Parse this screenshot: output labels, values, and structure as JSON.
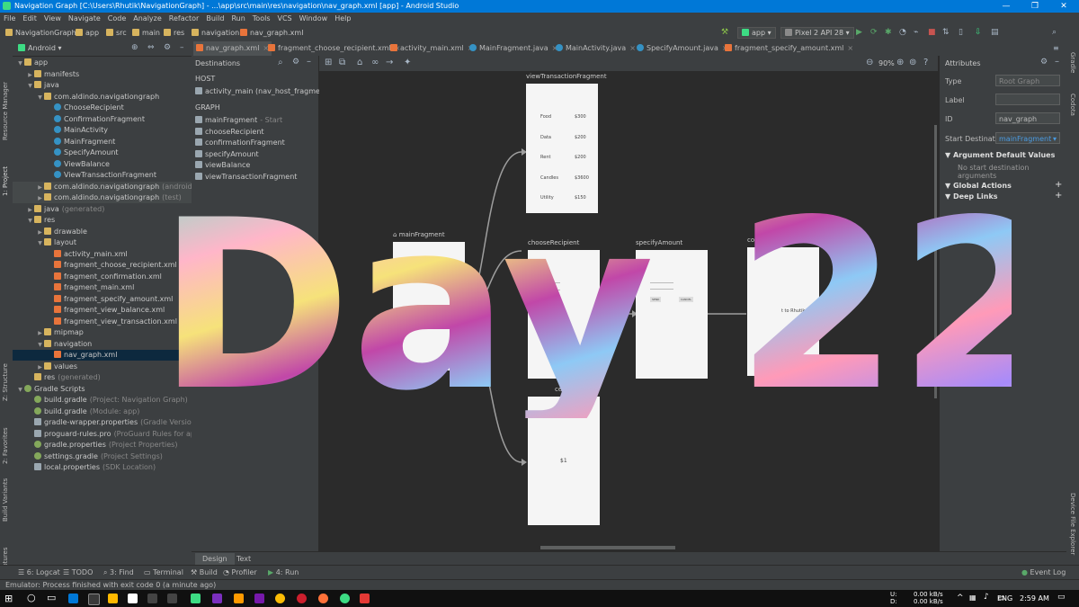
{
  "window": {
    "title": "Navigation Graph [C:\\Users\\Rhutik\\NavigationGraph] - ...\\app\\src\\main\\res\\navigation\\nav_graph.xml [app] - Android Studio",
    "controls": {
      "minimize": "—",
      "restore": "❐",
      "close": "✕"
    }
  },
  "menu": [
    "File",
    "Edit",
    "View",
    "Navigate",
    "Code",
    "Analyze",
    "Refactor",
    "Build",
    "Run",
    "Tools",
    "VCS",
    "Window",
    "Help"
  ],
  "breadcrumb": [
    "NavigationGraph",
    "app",
    "src",
    "main",
    "res",
    "navigation",
    "nav_graph.xml"
  ],
  "toolbar": {
    "module": "app",
    "device": "Pixel 2 API 28"
  },
  "project_panel": {
    "view_mode": "Android"
  },
  "tree": [
    {
      "label": "app",
      "level": 0,
      "icon": "folder",
      "arrow": "▼"
    },
    {
      "label": "manifests",
      "level": 1,
      "icon": "folder",
      "arrow": "▶"
    },
    {
      "label": "java",
      "level": 1,
      "icon": "folder",
      "arrow": "▼"
    },
    {
      "label": "com.aldindo.navigationgraph",
      "level": 2,
      "icon": "folder",
      "arrow": "▼"
    },
    {
      "label": "ChooseRecipient",
      "level": 3,
      "icon": "cls",
      "arrow": ""
    },
    {
      "label": "ConfirmationFragment",
      "level": 3,
      "icon": "cls",
      "arrow": ""
    },
    {
      "label": "MainActivity",
      "level": 3,
      "icon": "cls",
      "arrow": ""
    },
    {
      "label": "MainFragment",
      "level": 3,
      "icon": "cls",
      "arrow": ""
    },
    {
      "label": "SpecifyAmount",
      "level": 3,
      "icon": "cls",
      "arrow": ""
    },
    {
      "label": "ViewBalance",
      "level": 3,
      "icon": "cls",
      "arrow": ""
    },
    {
      "label": "ViewTransactionFragment",
      "level": 3,
      "icon": "cls",
      "arrow": ""
    },
    {
      "label": "com.aldindo.navigationgraph",
      "suffix": "(androidTest)",
      "level": 2,
      "icon": "folder",
      "arrow": "▶",
      "hl": true
    },
    {
      "label": "com.aldindo.navigationgraph",
      "suffix": "(test)",
      "level": 2,
      "icon": "folder",
      "arrow": "▶",
      "hl": true
    },
    {
      "label": "java",
      "suffix": "(generated)",
      "level": 1,
      "icon": "folder",
      "arrow": "▶"
    },
    {
      "label": "res",
      "level": 1,
      "icon": "folder",
      "arrow": "▼"
    },
    {
      "label": "drawable",
      "level": 2,
      "icon": "folder",
      "arrow": "▶"
    },
    {
      "label": "layout",
      "level": 2,
      "icon": "folder",
      "arrow": "▼"
    },
    {
      "label": "activity_main.xml",
      "level": 3,
      "icon": "xml",
      "arrow": ""
    },
    {
      "label": "fragment_choose_recipient.xml",
      "level": 3,
      "icon": "xml",
      "arrow": ""
    },
    {
      "label": "fragment_confirmation.xml",
      "level": 3,
      "icon": "xml",
      "arrow": ""
    },
    {
      "label": "fragment_main.xml",
      "level": 3,
      "icon": "xml",
      "arrow": ""
    },
    {
      "label": "fragment_specify_amount.xml",
      "level": 3,
      "icon": "xml",
      "arrow": ""
    },
    {
      "label": "fragment_view_balance.xml",
      "level": 3,
      "icon": "xml",
      "arrow": ""
    },
    {
      "label": "fragment_view_transaction.xml",
      "level": 3,
      "icon": "xml",
      "arrow": ""
    },
    {
      "label": "mipmap",
      "level": 2,
      "icon": "folder",
      "arrow": "▶"
    },
    {
      "label": "navigation",
      "level": 2,
      "icon": "folder",
      "arrow": "▼"
    },
    {
      "label": "nav_graph.xml",
      "level": 3,
      "icon": "xml",
      "arrow": "",
      "sel": true
    },
    {
      "label": "values",
      "level": 2,
      "icon": "folder",
      "arrow": "▶"
    },
    {
      "label": "res",
      "suffix": "(generated)",
      "level": 1,
      "icon": "folder",
      "arrow": ""
    },
    {
      "label": "Gradle Scripts",
      "level": 0,
      "icon": "gradle",
      "arrow": "▼"
    },
    {
      "label": "build.gradle",
      "suffix": "(Project: Navigation Graph)",
      "level": 1,
      "icon": "gradle",
      "arrow": ""
    },
    {
      "label": "build.gradle",
      "suffix": "(Module: app)",
      "level": 1,
      "icon": "gradle",
      "arrow": ""
    },
    {
      "label": "gradle-wrapper.properties",
      "suffix": "(Gradle Version)",
      "level": 1,
      "icon": "file",
      "arrow": ""
    },
    {
      "label": "proguard-rules.pro",
      "suffix": "(ProGuard Rules for app)",
      "level": 1,
      "icon": "file",
      "arrow": ""
    },
    {
      "label": "gradle.properties",
      "suffix": "(Project Properties)",
      "level": 1,
      "icon": "gradle",
      "arrow": ""
    },
    {
      "label": "settings.gradle",
      "suffix": "(Project Settings)",
      "level": 1,
      "icon": "gradle",
      "arrow": ""
    },
    {
      "label": "local.properties",
      "suffix": "(SDK Location)",
      "level": 1,
      "icon": "file",
      "arrow": ""
    }
  ],
  "tabs": [
    "nav_graph.xml",
    "fragment_choose_recipient.xml",
    "activity_main.xml",
    "MainFragment.java",
    "MainActivity.java",
    "SpecifyAmount.java",
    "fragment_specify_amount.xml"
  ],
  "destinations": {
    "title": "Destinations",
    "host_header": "HOST",
    "host": "activity_main (nav_host_fragment)",
    "graph_header": "GRAPH",
    "items": [
      {
        "name": "mainFragment",
        "note": "- Start"
      },
      {
        "name": "chooseRecipient",
        "note": ""
      },
      {
        "name": "confirmationFragment",
        "note": ""
      },
      {
        "name": "specifyAmount",
        "note": ""
      },
      {
        "name": "viewBalance",
        "note": ""
      },
      {
        "name": "viewTransactionFragment",
        "note": ""
      }
    ]
  },
  "graph": {
    "zoom": "90%",
    "fragments": {
      "viewTransaction": "viewTransactionFragment",
      "main": "mainFragment",
      "chooseRecipient": "chooseRecipient",
      "specifyAmount": "specifyAmount",
      "confirmation": "confirmationFra",
      "balanceLabel": "ce"
    },
    "transactions": [
      {
        "item": "Food",
        "amount": "$300"
      },
      {
        "item": "Data",
        "amount": "$200"
      },
      {
        "item": "Rent",
        "amount": "$200"
      },
      {
        "item": "Candles",
        "amount": "$3600"
      },
      {
        "item": "Utility",
        "amount": "$150"
      }
    ],
    "specify_buttons": [
      "SEND",
      "CANCEL"
    ],
    "confirmation_text": "t to Rhutik",
    "balance_value": "$1"
  },
  "attributes": {
    "title": "Attributes",
    "type_label": "Type",
    "type_value": "Root Graph",
    "label_label": "Label",
    "label_value": "",
    "id_label": "ID",
    "id_value": "nav_graph",
    "start_label": "Start Destination",
    "start_value": "mainFragment",
    "arg_section": "Argument Default Values",
    "arg_empty": "No start destination arguments",
    "global_section": "Global Actions",
    "deeplink_section": "Deep Links"
  },
  "bottom_tabs": [
    "Design",
    "Text"
  ],
  "left_strip": [
    "Resource Manager",
    "1: Project",
    "Z: Structure",
    "2: Favorites",
    "Build Variants",
    "Layout Captures"
  ],
  "right_strip": [
    "Gradle",
    "Codota",
    "Device File Explorer"
  ],
  "tool_windows": [
    "6: Logcat",
    "TODO",
    "3: Find",
    "Terminal",
    "Build",
    "Profiler",
    "4: Run"
  ],
  "event_log": "Event Log",
  "status": "Emulator: Process finished with exit code 0 (a minute ago)",
  "taskbar": {
    "upload_label": "U:",
    "download_label": "D:",
    "upload": "0.00 kB/s",
    "download": "0.00 kB/s",
    "lang": "ENG",
    "time": "2:59 AM"
  },
  "overlay_text": "Day 22"
}
